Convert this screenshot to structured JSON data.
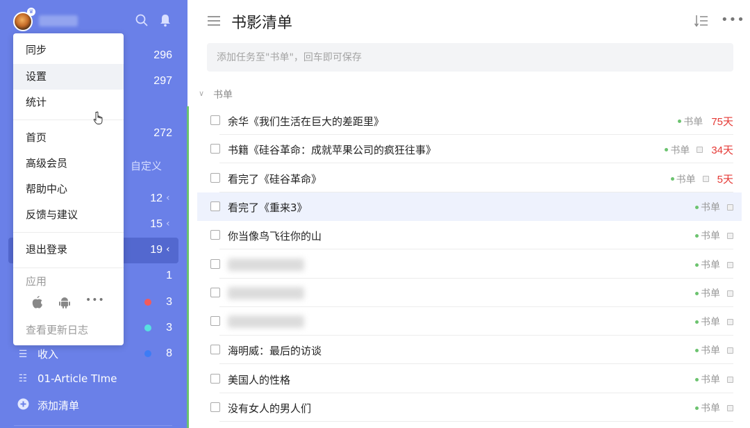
{
  "sidebar": {
    "counts": [
      "296",
      "297",
      "272"
    ],
    "custom_label": "自定义",
    "list_counts": [
      "12",
      "15",
      "19",
      "1",
      "3",
      "3",
      "8"
    ],
    "chevron": "‹",
    "colors": {
      "red_dot": "#f25b5b",
      "cyan_dot": "#57e0e0",
      "blue_dot": "#3d7cf5"
    },
    "bottom_items": [
      {
        "label": "收入",
        "icon": "list-icon"
      },
      {
        "label": "01-Article TIme",
        "icon": "filter-list-icon"
      },
      {
        "label": "添加清单",
        "icon": "add-circle-icon"
      }
    ]
  },
  "popup": {
    "items": [
      "同步",
      "设置",
      "统计",
      "首页",
      "高级会员",
      "帮助中心",
      "反馈与建议",
      "退出登录"
    ],
    "apps_label": "应用",
    "app_icons": [
      "apple-icon",
      "android-icon",
      "more-icon"
    ],
    "changelog": "查看更新日志"
  },
  "main": {
    "title": "书影清单",
    "add_placeholder": "添加任务至\"书单\"，回车即可保存",
    "section": "书单",
    "tasks": [
      {
        "title": "余华《我们生活在巨大的差距里》",
        "tag": "书单",
        "due": "75天"
      },
      {
        "title": "书籍《硅谷革命：成就苹果公司的疯狂往事》",
        "tag": "书单",
        "due": "34天"
      },
      {
        "title": "看完了《硅谷革命》",
        "tag": "书单",
        "due": "5天"
      },
      {
        "title": "看完了《重来3》",
        "tag": "书单",
        "due": ""
      },
      {
        "title": "你当像鸟飞往你的山",
        "tag": "书单",
        "due": ""
      },
      {
        "title": "",
        "tag": "书单",
        "due": ""
      },
      {
        "title": "",
        "tag": "书单",
        "due": ""
      },
      {
        "title": "",
        "tag": "书单",
        "due": ""
      },
      {
        "title": "海明威：最后的访谈",
        "tag": "书单",
        "due": ""
      },
      {
        "title": "美国人的性格",
        "tag": "书单",
        "due": ""
      },
      {
        "title": "没有女人的男人们",
        "tag": "书单",
        "due": ""
      }
    ]
  }
}
